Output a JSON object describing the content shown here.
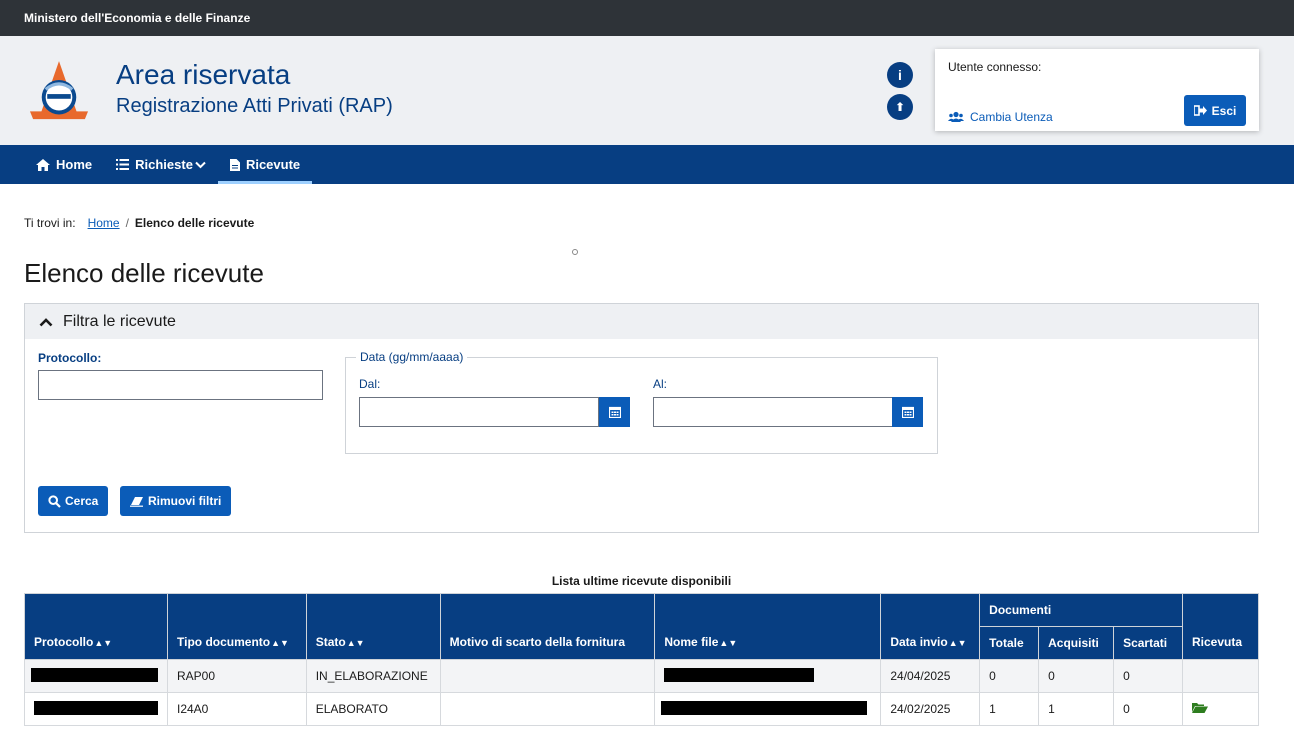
{
  "topbar": {
    "ministry": "Ministero dell'Economia e delle Finanze"
  },
  "header": {
    "title": "Area riservata",
    "subtitle": "Registrazione Atti Privati (RAP)",
    "info_glyph": "i",
    "upload_glyph": "⬆",
    "user_box": {
      "label": "Utente connesso:",
      "change_user": "Cambia Utenza",
      "logout": "Esci"
    }
  },
  "nav": {
    "home": "Home",
    "requests": "Richieste",
    "receipts": "Ricevute"
  },
  "breadcrumb": {
    "prefix": "Ti trovi in:",
    "home": "Home",
    "separator": "/",
    "current": "Elenco delle ricevute"
  },
  "page": {
    "title": "Elenco delle ricevute"
  },
  "filter": {
    "title": "Filtra le ricevute",
    "protocol_label": "Protocollo:",
    "date_legend": "Data (gg/mm/aaaa)",
    "from_label": "Dal:",
    "to_label": "Al:",
    "search_button": "Cerca",
    "clear_button": "Rimuovi filtri"
  },
  "table": {
    "caption": "Lista ultime ricevute disponibili",
    "headers": {
      "protocollo": "Protocollo",
      "tipo": "Tipo documento",
      "stato": "Stato",
      "motivo": "Motivo di scarto della fornitura",
      "nome_file": "Nome file",
      "data_invio": "Data invio",
      "documenti": "Documenti",
      "totale": "Totale",
      "acquisiti": "Acquisiti",
      "scartati": "Scartati",
      "ricevuta": "Ricevuta"
    },
    "rows": [
      {
        "tipo": "RAP00",
        "stato": "IN_ELABORAZIONE",
        "motivo": "",
        "data_invio": "24/04/2025",
        "totale": "0",
        "acquisiti": "0",
        "scartati": "0"
      },
      {
        "tipo": "I24A0",
        "stato": "ELABORATO",
        "motivo": "",
        "data_invio": "24/02/2025",
        "totale": "1",
        "acquisiti": "1",
        "scartati": "0"
      }
    ]
  },
  "colors": {
    "primary": "#073e82",
    "button": "#0b5cb8",
    "topbar": "#2e3338",
    "header_bg": "#eef0f3",
    "folder_icon": "#2e7d1f"
  }
}
